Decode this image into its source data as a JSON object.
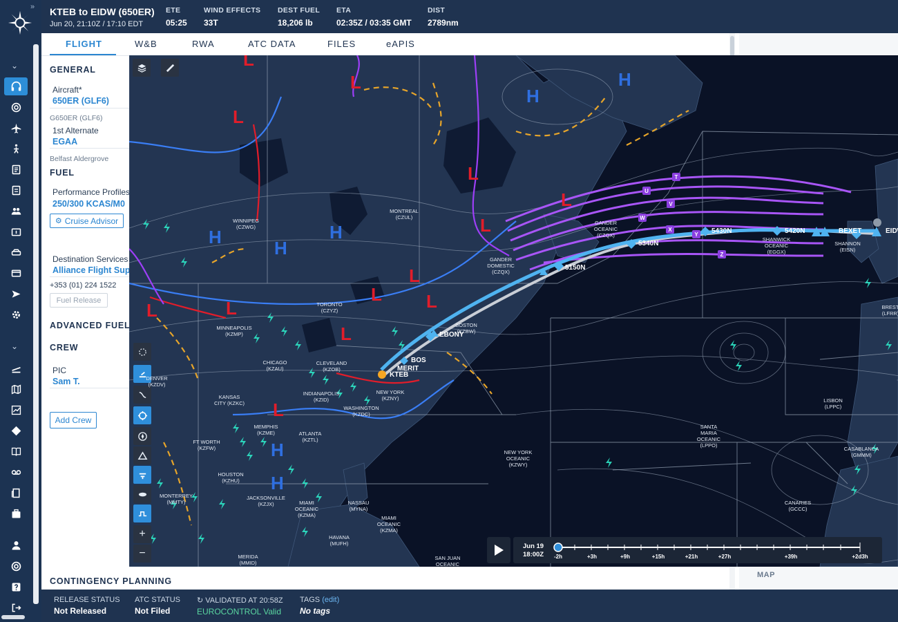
{
  "header": {
    "route_title": "KTEB to EIDW (650ER)",
    "route_sub": "Jun 20, 21:10Z / 17:10 EDT",
    "stats": [
      {
        "label": "ETE",
        "value": "05:25"
      },
      {
        "label": "WIND EFFECTS",
        "value": "33T"
      },
      {
        "label": "DEST FUEL",
        "value": "18,206 lb"
      },
      {
        "label": "ETA",
        "value": "02:35Z / 03:35 GMT"
      },
      {
        "label": "DIST",
        "value": "2789nm"
      }
    ]
  },
  "tabs": [
    {
      "label": "FLIGHT",
      "active": true
    },
    {
      "label": "W&B"
    },
    {
      "label": "RWA"
    },
    {
      "label": "ATC DATA"
    },
    {
      "label": "FILES"
    },
    {
      "label": "eAPIS"
    }
  ],
  "left": {
    "general": "GENERAL",
    "aircraft_label": "Aircraft*",
    "aircraft_value": "650ER (GLF6)",
    "aircraft_type": "G650ER (GLF6)",
    "alternate_label": "1st Alternate",
    "alternate_value": "EGAA",
    "alternate_name": "Belfast Aldergrove",
    "fuel": "FUEL",
    "perf_label": "Performance Profiles",
    "perf_value": "250/300 KCAS/M0",
    "cruise_advisor": "Cruise Advisor",
    "dest_services_label": "Destination Services",
    "dest_services_value": "Alliance Flight Sup",
    "phone": "+353 (01) 224 1522",
    "fuel_release": "Fuel Release",
    "adv_fuel": "ADVANCED FUEL",
    "crew": "CREW",
    "pic_label": "PIC",
    "pic_value": "Sam T.",
    "add_crew": "Add Crew",
    "contingency": "CONTINGENCY PLANNING"
  },
  "right": {
    "map_label": "MAP"
  },
  "map": {
    "cities": [
      {
        "name": "WINNIPEG\n(CZWG)"
      },
      {
        "name": "MONTREAL\n(CZUL)"
      },
      {
        "name": "GANDER\nOCEANIC\n(CZQX)"
      },
      {
        "name": "GANDER\nDOMESTIC\n(CZQX)"
      },
      {
        "name": "TORONTO\n(CZYZ)"
      },
      {
        "name": "MINNEAPOLIS\n(KZMP)"
      },
      {
        "name": "CHICAGO\n(KZAU)"
      },
      {
        "name": "CLEVELAND\n(KZOB)"
      },
      {
        "name": "DENVER\n(KZDV)"
      },
      {
        "name": "KANSAS\nCITY (KZKC)"
      },
      {
        "name": "INDIANAPOLIS\n(KZID)"
      },
      {
        "name": "NEW YORK\n(KZNY)"
      },
      {
        "name": "WASHINGTON\n(KZDC)"
      },
      {
        "name": "MEMPHIS\n(KZME)"
      },
      {
        "name": "ATLANTA\n(KZTL)"
      },
      {
        "name": "FT WORTH\n(KZFW)"
      },
      {
        "name": "HOUSTON\n(KZHU)"
      },
      {
        "name": "JACKSONVILLE\n(KZJX)"
      },
      {
        "name": "MIAMI\nOCEANIC\n(KZMA)"
      },
      {
        "name": "NASSAU\n(MYNA)"
      },
      {
        "name": "MIAMI\nOCEANIC\n(KZMA)"
      },
      {
        "name": "HAVANA\n(MUFH)"
      },
      {
        "name": "MONTERREY\n(MMTY)"
      },
      {
        "name": "MERIDA\n(MMID)"
      },
      {
        "name": "SAN JUAN\nOCEANIC"
      },
      {
        "name": "NEW YORK\nOCEANIC\n(KZWY)"
      },
      {
        "name": "SANTA\nMARIA\nOCEANIC\n(LPPO)"
      },
      {
        "name": "SHANWICK\nOCEANIC\n(EGGX)"
      },
      {
        "name": "SHANNON\n(EISN)"
      },
      {
        "name": "LISBON\n(LPPC)"
      },
      {
        "name": "CANARIES\n(GCCC)"
      },
      {
        "name": "CASABLANCA\n(GMMM)"
      },
      {
        "name": "BREST\n(LFRR)"
      },
      {
        "name": "BOSTON\n(KZBW)"
      }
    ],
    "waypoints": [
      "KTEB",
      "MERIT",
      "BOS",
      "EBONY",
      "5150N",
      "5340N",
      "5430N",
      "5420N",
      "BEXET",
      "EIDW"
    ],
    "track_letters": [
      "T",
      "U",
      "V",
      "W",
      "X",
      "Y",
      "Z"
    ],
    "pressure_labels": [
      "L",
      "H"
    ],
    "timeline": {
      "date": "Jun 19",
      "time": "18:00Z",
      "ticks": [
        "-2h",
        "+3h",
        "+9h",
        "+15h",
        "+21h",
        "+27h",
        "+39h",
        "+2d3h"
      ]
    }
  },
  "footer": {
    "release_status_label": "RELEASE STATUS",
    "release_status_value": "Not Released",
    "atc_status_label": "ATC STATUS",
    "atc_status_value": "Not Filed",
    "validated_label": "VALIDATED AT 20:58Z",
    "validated_value": "EUROCONTROL Valid",
    "tags_label": "TAGS",
    "tags_edit": "(edit)",
    "tags_value": "No tags"
  },
  "colors": {
    "navy": "#1f3350",
    "accent": "#2b86d1",
    "map_bg": "#0a1226",
    "route": "#4fb3f0",
    "nat_tracks": "#a855f7",
    "low": "#e11d2a",
    "high": "#2f6fe0"
  }
}
